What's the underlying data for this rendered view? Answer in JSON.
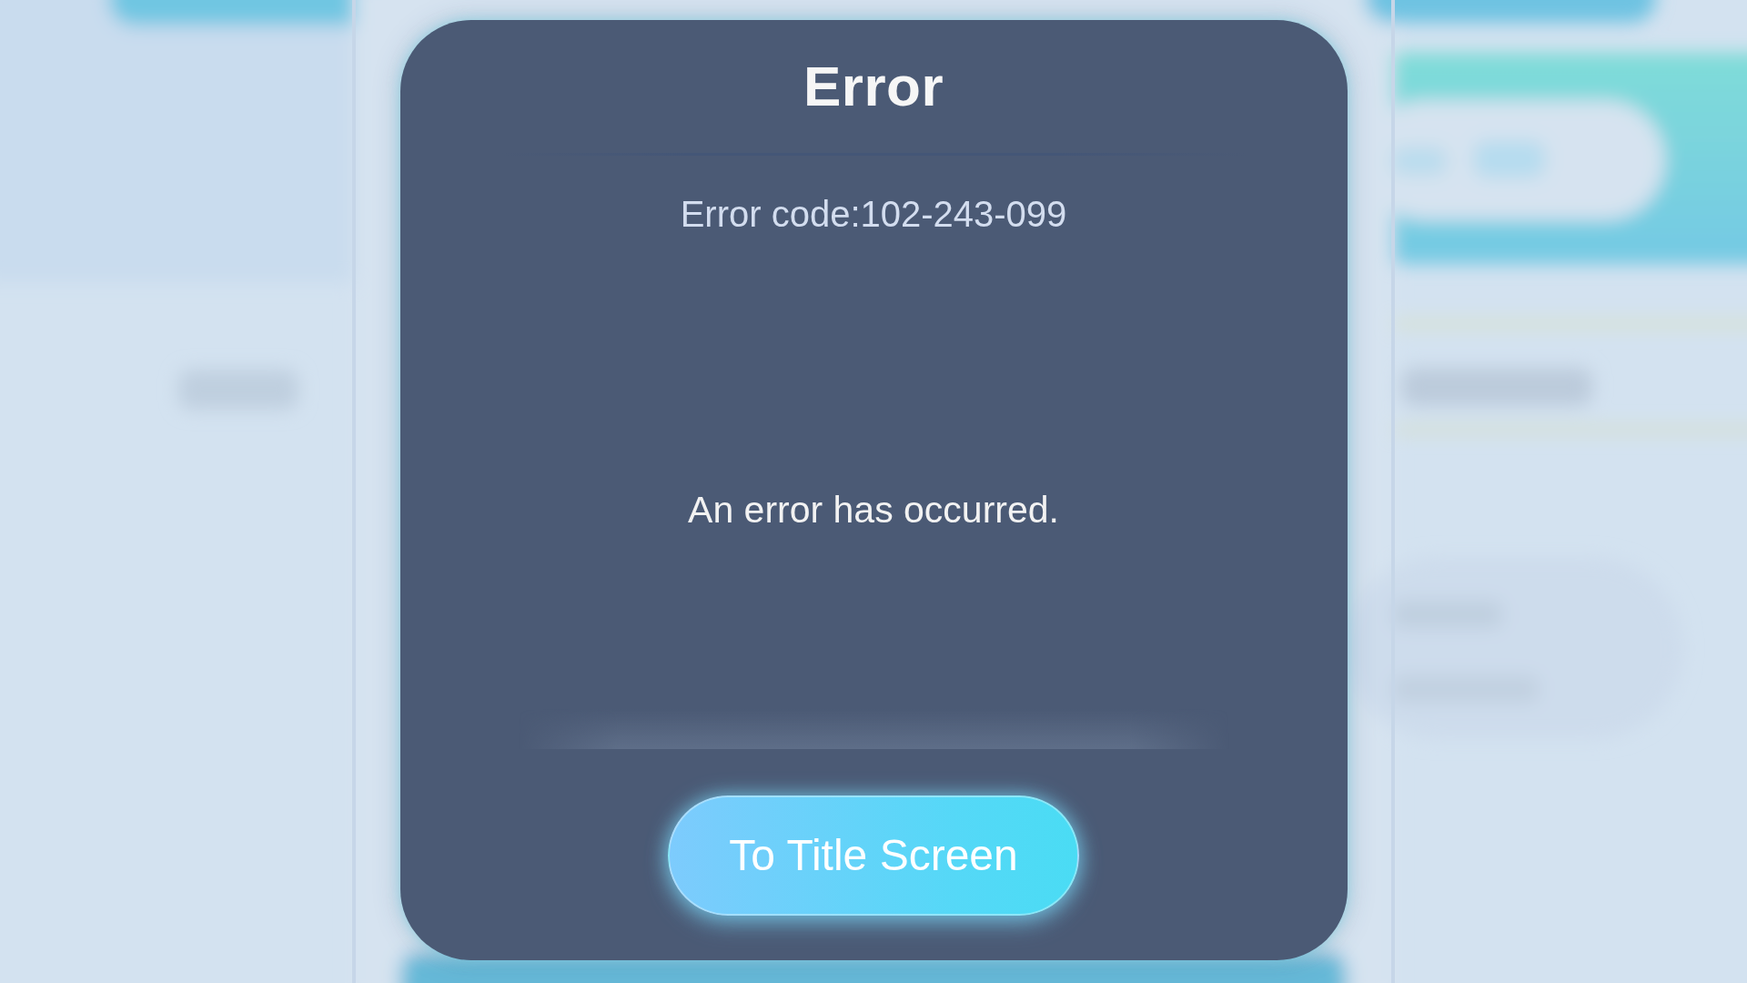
{
  "dialog": {
    "title": "Error",
    "error_code": "Error code:102-243-099",
    "message": "An error has occurred.",
    "button": {
      "label": "To Title Screen"
    }
  }
}
